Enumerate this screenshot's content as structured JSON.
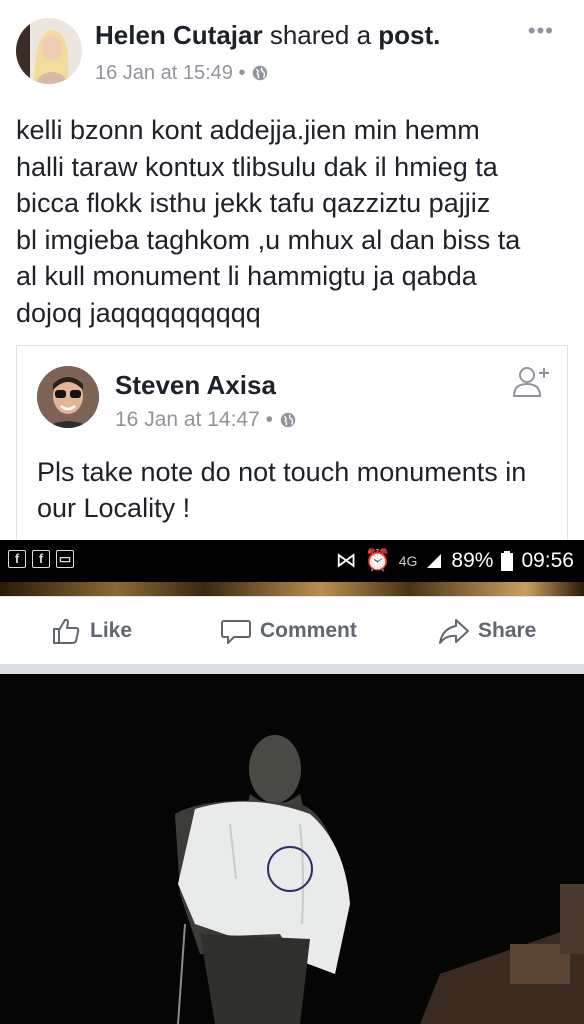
{
  "post": {
    "author": "Helen Cutajar",
    "action_text": "shared a",
    "object_text": "post.",
    "timestamp": "16 Jan at 15:49",
    "separator": "•",
    "more_label": "•••",
    "text_lines": [
      "kelli bzonn kont addejja.jien min hemm",
      "halli taraw kontux tlibsulu dak il hmieg ta",
      "bicca flokk isthu jekk tafu qazziztu pajjiz",
      "bl imgieba taghkom ,u mhux al dan biss ta",
      "al kull monument li hammigtu ja qabda",
      "dojoq jaqqqqqqqqqq"
    ]
  },
  "shared_post": {
    "author": "Steven Axisa",
    "timestamp": "16 Jan at 14:47",
    "separator": "•",
    "text": "Pls take note do not touch monuments in our Locality !"
  },
  "status_bar": {
    "network": "4G",
    "battery": "89%",
    "time": "09:56"
  },
  "actions": {
    "like": "Like",
    "comment": "Comment",
    "share": "Share"
  },
  "colors": {
    "text": "#1d2129",
    "meta": "#90949c",
    "action": "#606770",
    "separator_band": "#dadde1"
  }
}
